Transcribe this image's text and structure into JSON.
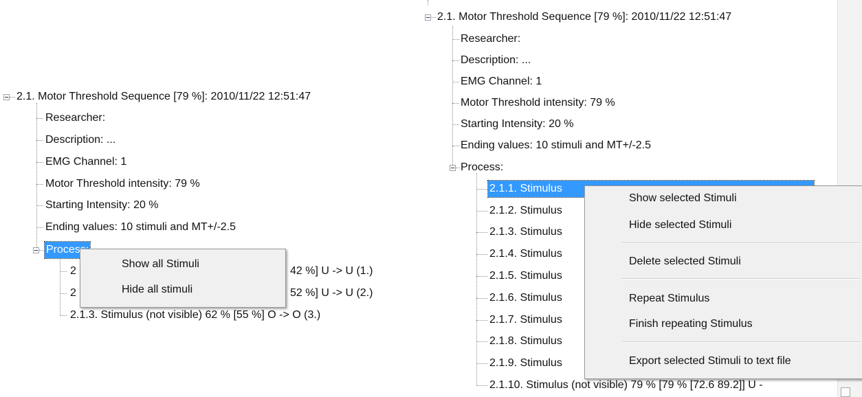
{
  "left": {
    "root_label": "2.1. Motor Threshold Sequence [79 %]: 2010/11/22 12:51:47",
    "children": [
      "Researcher:",
      "Description: ...",
      "EMG Channel: 1",
      "Motor Threshold intensity:  79 %",
      "Starting Intensity: 20 %",
      "Ending values: 10 stimuli and MT+/-2.5"
    ],
    "process_label": "Process:",
    "process_children": [
      {
        "prefix": "2",
        "suffix": "42 %] U -> U (1.)"
      },
      {
        "prefix": "2",
        "suffix": "52 %] U -> U (2.)"
      },
      {
        "prefix": "2.1.3. Stimulus  (not visible) 62 % [55 %] O -> O (3.)",
        "suffix": ""
      }
    ],
    "menu": [
      "Show all Stimuli",
      "Hide all stimuli"
    ]
  },
  "right": {
    "root_label": "2.1. Motor Threshold Sequence [79 %]: 2010/11/22 12:51:47",
    "children": [
      "Researcher:",
      "Description: ...",
      "EMG Channel: 1",
      "Motor Threshold intensity:  79 %",
      "Starting Intensity: 20 %",
      "Ending values: 10 stimuli and MT+/-2.5"
    ],
    "process_label": "Process:",
    "stimuli": [
      "2.1.1. Stimulus",
      "2.1.2. Stimulus",
      "2.1.3. Stimulus",
      "2.1.4. Stimulus",
      "2.1.5. Stimulus",
      "2.1.6. Stimulus",
      "2.1.7. Stimulus",
      "2.1.8. Stimulus",
      "2.1.9. Stimulus",
      "2.1.10. Stimulus  (not visible) 79 % [79 % [72.6 89.2]] U -"
    ],
    "menu": [
      "Show selected Stimuli",
      "Hide selected Stimuli",
      "Delete selected Stimuli",
      "Repeat Stimulus",
      "Finish repeating Stimulus",
      "Export selected Stimuli to text file"
    ]
  }
}
